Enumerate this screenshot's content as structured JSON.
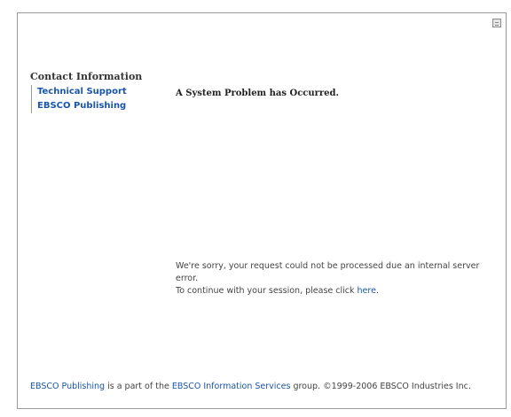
{
  "sidebar": {
    "heading": "Contact Information",
    "links": [
      {
        "label": "Technical Support"
      },
      {
        "label": "EBSCO Publishing"
      }
    ]
  },
  "main": {
    "title": "A System Problem has Occurred.",
    "message_line1": "We're sorry, your request could not be processed due an internal server error.",
    "continue_prefix": "To continue with your session, please click",
    "continue_link": "here",
    "continue_suffix": "."
  },
  "footer": {
    "link1": "EBSCO Publishing",
    "text1": " is a part of the ",
    "link2": "EBSCO Information Services",
    "text2": " group. ©1999-2006 EBSCO Industries Inc."
  },
  "colors": {
    "link": "#1a55a8",
    "border": "#9a9a9a"
  }
}
